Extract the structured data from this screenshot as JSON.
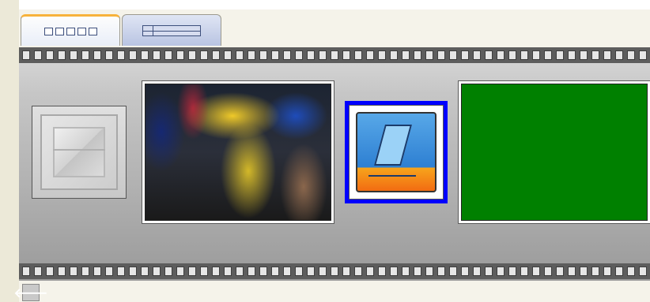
{
  "tabs": [
    {
      "label": "",
      "icon": "storyboard-icon",
      "active": true
    },
    {
      "label": "",
      "icon": "timeline-icon",
      "active": false
    }
  ],
  "storyboard": {
    "items": [
      {
        "type": "transition",
        "icon": "transition-placeholder-icon"
      },
      {
        "type": "clip",
        "content": "concert-photo"
      },
      {
        "type": "clip",
        "icon": "effect-clip-icon",
        "selected": true
      },
      {
        "type": "clip",
        "content": "solid-green"
      }
    ]
  },
  "colors": {
    "selection": "#0000ff",
    "active_tab_accent": "#f7b23b",
    "green_clip": "#008000",
    "film_perforation": "#5d5d5d"
  },
  "controls": {
    "back_icon": "arrow-left-icon",
    "back_glyph": "🡐"
  }
}
